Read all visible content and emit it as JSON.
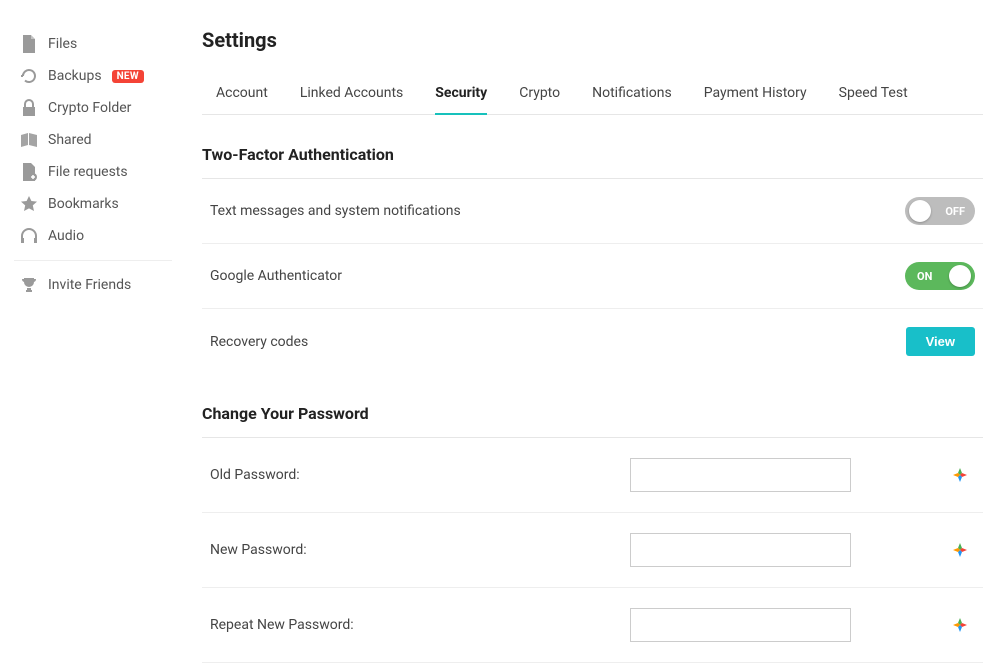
{
  "sidebar": {
    "items": [
      {
        "label": "Files"
      },
      {
        "label": "Backups",
        "badge": "NEW"
      },
      {
        "label": "Crypto Folder"
      },
      {
        "label": "Shared"
      },
      {
        "label": "File requests"
      },
      {
        "label": "Bookmarks"
      },
      {
        "label": "Audio"
      }
    ],
    "invite": {
      "label": "Invite Friends"
    }
  },
  "page": {
    "title": "Settings"
  },
  "tabs": [
    {
      "label": "Account"
    },
    {
      "label": "Linked Accounts"
    },
    {
      "label": "Security",
      "active": true
    },
    {
      "label": "Crypto"
    },
    {
      "label": "Notifications"
    },
    {
      "label": "Payment History"
    },
    {
      "label": "Speed Test"
    }
  ],
  "twofa": {
    "heading": "Two-Factor Authentication",
    "sms_label": "Text messages and system notifications",
    "ga_label": "Google Authenticator",
    "recovery_label": "Recovery codes",
    "off_text": "OFF",
    "on_text": "ON",
    "view_button": "View"
  },
  "password": {
    "heading": "Change Your Password",
    "old_label": "Old Password:",
    "new_label": "New Password:",
    "repeat_label": "Repeat New Password:",
    "old_value": "",
    "new_value": "",
    "repeat_value": ""
  }
}
